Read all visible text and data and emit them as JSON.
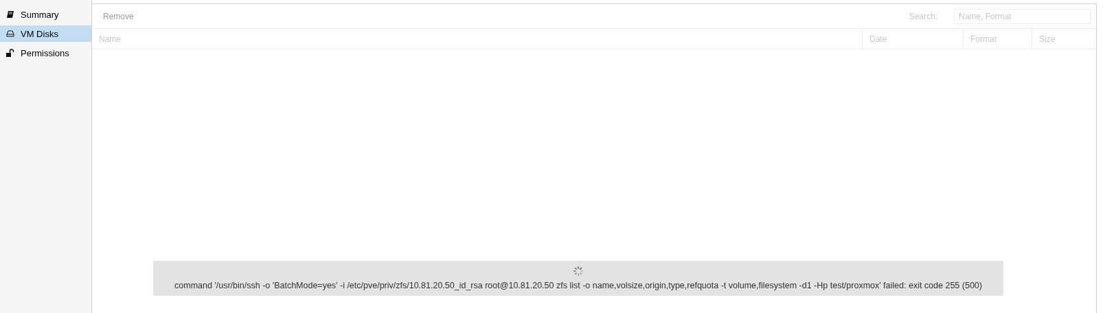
{
  "sidebar": {
    "items": [
      {
        "label": "Summary",
        "kind": "book",
        "selected": false
      },
      {
        "label": "VM Disks",
        "kind": "disk",
        "selected": true
      },
      {
        "label": "Permissions",
        "kind": "lock",
        "selected": false
      }
    ]
  },
  "toolbar": {
    "remove_button": {
      "label": "Remove",
      "disabled": true
    },
    "search_label": "Search:",
    "search": {
      "placeholder": "Name, Format"
    }
  },
  "table": {
    "columns": [
      "Name",
      "Date",
      "Format",
      "Size"
    ]
  },
  "load_mask": {
    "message": "command '/usr/bin/ssh -o 'BatchMode=yes' -i /etc/pve/priv/zfs/10.81.20.50_id_rsa root@10.81.20.50 zfs list -o name,volsize,origin,type,refquota -t volume,filesystem -d1 -Hp test/proxmox' failed: exit code 255 (500)"
  }
}
